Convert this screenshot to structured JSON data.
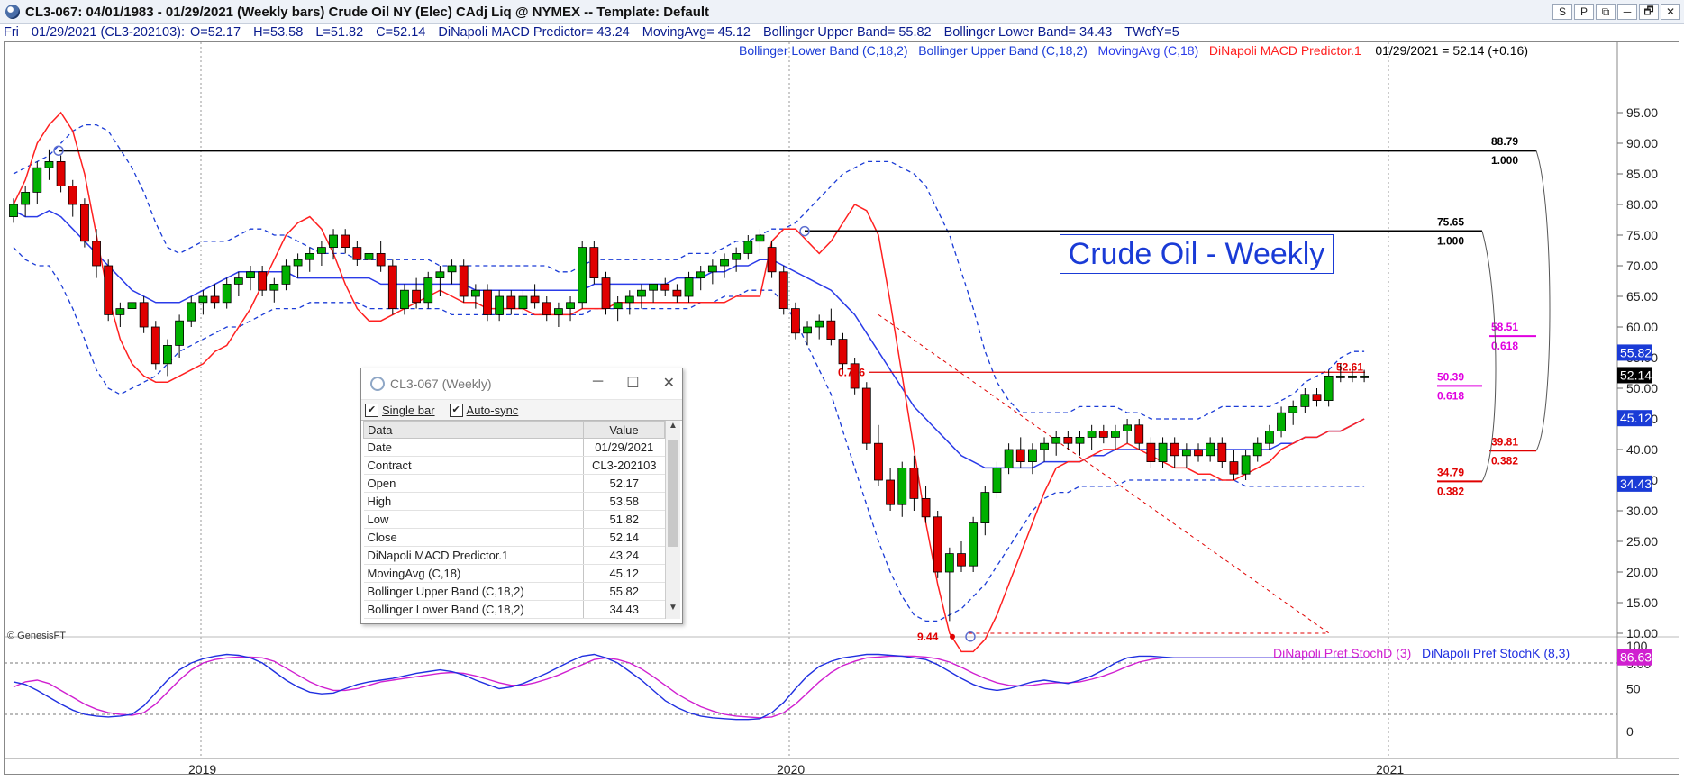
{
  "window": {
    "title": "CL3-067:  04/01/1983 - 01/29/2021  (Weekly bars)   Crude Oil NY (Elec) CAdj Liq @ NYMEX  --  Template: Default",
    "buttons": [
      "S",
      "P",
      "⧉",
      "─",
      "🗗",
      "✕"
    ]
  },
  "infobar": {
    "day": "Fri",
    "bar": "01/29/2021 (CL3-202103):",
    "open": "O=52.17",
    "high": "H=53.58",
    "low": "L=51.82",
    "close": "C=52.14",
    "dinapoli": "DiNapoli MACD Predictor= 43.24",
    "ma": "MovingAvg= 45.12",
    "bbu": "Bollinger Upper Band= 55.82",
    "bbl": "Bollinger Lower Band= 34.43",
    "twofy": "TWofY=5"
  },
  "legend": {
    "bbl": "Bollinger Lower Band (C,18,2)",
    "bbu": "Bollinger Upper Band (C,18,2)",
    "ma": "MovingAvg (C,18)",
    "dinapoli": "DiNapoli MACD Predictor.1",
    "last": "01/29/2021 = 52.14 (+0.16)"
  },
  "watermark": "Crude Oil - Weekly",
  "copyright": "© GenesisFT",
  "stoch_legend": {
    "d": "DiNapoli Pref StochD (3)",
    "k": "DiNapoli Pref StochK (8,3)"
  },
  "price_axis": [
    "95.00",
    "90.00",
    "85.00",
    "80.00",
    "75.00",
    "70.00",
    "65.00",
    "60.00",
    "55.00",
    "50.00",
    "45.00",
    "40.00",
    "35.00",
    "30.00",
    "25.00",
    "20.00",
    "15.00",
    "10.00",
    "5.00"
  ],
  "stoch_axis": [
    "100",
    "50",
    "0"
  ],
  "time_axis": [
    "2019",
    "2020",
    "2021"
  ],
  "tags": {
    "bbu": "55.82",
    "close": "52.14",
    "ma": "45.12",
    "bbl": "34.43",
    "stoch": "86.63"
  },
  "levels": {
    "l1_price": "88.79",
    "l1_ratio": "1.000",
    "l2_price": "75.65",
    "l2_ratio": "1.000",
    "l3_price": "58.51",
    "l3_ratio": "0.618",
    "l4_price": "50.39",
    "l4_ratio": "0.618",
    "l5_price": "39.81",
    "l5_ratio": "0.382",
    "l6_price": "34.79",
    "l6_ratio": "0.382",
    "fib_ratio": "0.786",
    "fib_price": "52.61",
    "low_mark": "9.44"
  },
  "colors": {
    "up": "#00b000",
    "down": "#e00000",
    "bb": "#1a3bd6",
    "ma": "#2a3be8",
    "macd": "#ff2020",
    "stochd": "#d020d0",
    "stochk": "#2030e0",
    "magenta": "#e000e0"
  },
  "data_window": {
    "title": "CL3-067 (Weekly)",
    "single_bar": "Single bar",
    "auto_sync": "Auto-sync",
    "headers": [
      "Data",
      "Value"
    ],
    "rows": [
      [
        "Date",
        "01/29/2021"
      ],
      [
        "Contract",
        "CL3-202103"
      ],
      [
        "Open",
        "52.17"
      ],
      [
        "High",
        "53.58"
      ],
      [
        "Low",
        "51.82"
      ],
      [
        "Close",
        "52.14"
      ],
      [
        "DiNapoli MACD Predictor.1",
        "43.24"
      ],
      [
        "MovingAvg (C,18)",
        "45.12"
      ],
      [
        "Bollinger Upper Band (C,18,2)",
        "55.82"
      ],
      [
        "Bollinger Lower Band (C,18,2)",
        "34.43"
      ]
    ]
  },
  "chart_data": {
    "type": "candlestick",
    "title": "Crude Oil - Weekly",
    "ylim": [
      5,
      97
    ],
    "ohlc": [
      [
        78,
        81,
        77,
        80
      ],
      [
        80,
        83,
        78,
        82
      ],
      [
        82,
        87,
        80,
        86
      ],
      [
        86,
        89,
        84,
        87
      ],
      [
        87,
        88,
        82,
        83
      ],
      [
        83,
        84,
        78,
        80
      ],
      [
        80,
        81,
        73,
        74
      ],
      [
        74,
        76,
        68,
        70
      ],
      [
        70,
        71,
        61,
        62
      ],
      [
        62,
        64,
        60,
        63
      ],
      [
        63,
        65,
        60,
        64
      ],
      [
        64,
        65,
        59,
        60
      ],
      [
        60,
        61,
        53,
        54
      ],
      [
        54,
        58,
        52,
        57
      ],
      [
        57,
        62,
        55,
        61
      ],
      [
        61,
        65,
        60,
        64
      ],
      [
        64,
        66,
        62,
        65
      ],
      [
        65,
        67,
        63,
        64
      ],
      [
        64,
        68,
        63,
        67
      ],
      [
        67,
        69,
        65,
        68
      ],
      [
        68,
        70,
        66,
        69
      ],
      [
        69,
        70,
        65,
        66
      ],
      [
        66,
        68,
        64,
        67
      ],
      [
        67,
        71,
        66,
        70
      ],
      [
        70,
        72,
        68,
        71
      ],
      [
        71,
        73,
        69,
        72
      ],
      [
        72,
        74,
        70,
        73
      ],
      [
        73,
        76,
        71,
        75
      ],
      [
        75,
        76,
        72,
        73
      ],
      [
        73,
        74,
        70,
        71
      ],
      [
        71,
        73,
        68,
        72
      ],
      [
        72,
        74,
        69,
        70
      ],
      [
        70,
        71,
        62,
        63
      ],
      [
        63,
        67,
        62,
        66
      ],
      [
        66,
        68,
        63,
        64
      ],
      [
        64,
        69,
        63,
        68
      ],
      [
        68,
        70,
        65,
        69
      ],
      [
        69,
        71,
        67,
        70
      ],
      [
        70,
        71,
        64,
        65
      ],
      [
        65,
        67,
        63,
        66
      ],
      [
        66,
        67,
        61,
        62
      ],
      [
        62,
        66,
        61,
        65
      ],
      [
        65,
        66,
        62,
        63
      ],
      [
        63,
        66,
        62,
        65
      ],
      [
        65,
        67,
        63,
        64
      ],
      [
        64,
        65,
        61,
        62
      ],
      [
        62,
        64,
        60,
        63
      ],
      [
        63,
        65,
        61,
        64
      ],
      [
        64,
        74,
        63,
        73
      ],
      [
        73,
        74,
        67,
        68
      ],
      [
        68,
        69,
        62,
        63
      ],
      [
        63,
        65,
        61,
        64
      ],
      [
        64,
        66,
        62,
        65
      ],
      [
        65,
        67,
        63,
        66
      ],
      [
        66,
        67,
        64,
        67
      ],
      [
        67,
        68,
        65,
        66
      ],
      [
        66,
        67,
        64,
        65
      ],
      [
        65,
        69,
        64,
        68
      ],
      [
        68,
        70,
        66,
        69
      ],
      [
        69,
        71,
        67,
        70
      ],
      [
        70,
        72,
        68,
        71
      ],
      [
        71,
        73,
        69,
        72
      ],
      [
        72,
        75,
        71,
        74
      ],
      [
        74,
        76,
        72,
        75
      ],
      [
        73,
        74,
        68,
        69
      ],
      [
        69,
        70,
        62,
        63
      ],
      [
        63,
        64,
        58,
        59
      ],
      [
        59,
        61,
        57,
        60
      ],
      [
        60,
        62,
        58,
        61
      ],
      [
        61,
        63,
        57,
        58
      ],
      [
        58,
        59,
        53,
        54
      ],
      [
        54,
        55,
        49,
        50
      ],
      [
        50,
        51,
        40,
        41
      ],
      [
        41,
        44,
        34,
        35
      ],
      [
        35,
        37,
        30,
        31
      ],
      [
        31,
        38,
        29,
        37
      ],
      [
        37,
        39,
        30,
        32
      ],
      [
        32,
        34,
        28,
        29
      ],
      [
        29,
        30,
        19,
        20
      ],
      [
        20,
        24,
        12,
        23
      ],
      [
        23,
        25,
        20,
        21
      ],
      [
        21,
        29,
        20,
        28
      ],
      [
        28,
        34,
        26,
        33
      ],
      [
        33,
        38,
        32,
        37
      ],
      [
        37,
        41,
        36,
        40
      ],
      [
        40,
        42,
        37,
        38
      ],
      [
        38,
        41,
        36,
        40
      ],
      [
        40,
        42,
        38,
        41
      ],
      [
        41,
        43,
        39,
        42
      ],
      [
        42,
        43,
        40,
        41
      ],
      [
        41,
        43,
        39,
        42
      ],
      [
        42,
        44,
        40,
        43
      ],
      [
        43,
        44,
        41,
        42
      ],
      [
        42,
        44,
        40,
        43
      ],
      [
        43,
        45,
        41,
        44
      ],
      [
        44,
        45,
        40,
        41
      ],
      [
        41,
        42,
        37,
        38
      ],
      [
        38,
        42,
        37,
        41
      ],
      [
        41,
        42,
        37,
        39
      ],
      [
        39,
        41,
        37,
        40
      ],
      [
        40,
        41,
        38,
        39
      ],
      [
        39,
        42,
        38,
        41
      ],
      [
        41,
        42,
        37,
        38
      ],
      [
        38,
        40,
        35,
        36
      ],
      [
        36,
        40,
        35,
        39
      ],
      [
        39,
        42,
        38,
        41
      ],
      [
        41,
        44,
        40,
        43
      ],
      [
        43,
        47,
        42,
        46
      ],
      [
        46,
        48,
        44,
        47
      ],
      [
        47,
        50,
        46,
        49
      ],
      [
        49,
        50,
        47,
        48
      ],
      [
        48,
        53,
        47,
        52
      ],
      [
        52,
        54,
        51,
        52
      ],
      [
        52,
        53,
        51,
        52
      ],
      [
        52,
        53,
        51,
        52
      ]
    ],
    "ma": [
      79,
      78,
      78,
      79,
      78,
      76,
      74,
      72,
      70,
      68,
      66,
      65,
      64,
      64,
      64,
      65,
      66,
      67,
      68,
      69,
      69,
      69,
      69,
      69,
      68,
      68,
      68,
      68,
      68,
      68,
      68,
      67,
      67,
      67,
      67,
      67,
      67,
      67,
      67,
      66,
      66,
      66,
      66,
      66,
      66,
      66,
      66,
      66,
      66,
      67,
      67,
      67,
      67,
      67,
      67,
      67,
      68,
      68,
      68,
      69,
      69,
      70,
      70,
      71,
      71,
      70,
      69,
      68,
      67,
      66,
      64,
      62,
      59,
      56,
      53,
      50,
      47,
      45,
      43,
      41,
      39,
      38,
      37,
      37,
      37,
      37,
      37,
      38,
      38,
      38,
      38,
      39,
      39,
      40,
      40,
      40,
      40,
      40,
      40,
      40,
      40,
      40,
      40,
      40,
      40,
      40,
      40,
      41,
      41,
      42,
      42,
      43,
      43,
      44,
      45
    ],
    "bbu": [
      85,
      86,
      87,
      88,
      90,
      92,
      93,
      93,
      92,
      89,
      86,
      82,
      77,
      73,
      72,
      73,
      74,
      74,
      74,
      75,
      76,
      76,
      75,
      75,
      74,
      73,
      72,
      72,
      72,
      71,
      71,
      71,
      71,
      71,
      71,
      71,
      70,
      70,
      70,
      70,
      70,
      70,
      70,
      70,
      70,
      70,
      69,
      69,
      70,
      71,
      71,
      71,
      71,
      71,
      71,
      71,
      71,
      72,
      72,
      72,
      73,
      74,
      74,
      75,
      76,
      76,
      77,
      79,
      81,
      83,
      85,
      86,
      87,
      87,
      87,
      86,
      85,
      83,
      79,
      75,
      69,
      63,
      56,
      51,
      48,
      46,
      46,
      46,
      46,
      46,
      47,
      47,
      47,
      47,
      46,
      46,
      45,
      45,
      45,
      45,
      45,
      46,
      47,
      47,
      47,
      47,
      47,
      48,
      49,
      51,
      52,
      53,
      55,
      56,
      56
    ],
    "bbl": [
      73,
      71,
      70,
      70,
      67,
      63,
      58,
      53,
      50,
      49,
      50,
      51,
      52,
      54,
      56,
      57,
      58,
      59,
      60,
      60,
      61,
      62,
      63,
      63,
      63,
      64,
      64,
      64,
      64,
      64,
      63,
      63,
      63,
      63,
      63,
      63,
      63,
      62,
      62,
      62,
      62,
      62,
      62,
      62,
      62,
      62,
      62,
      62,
      62,
      63,
      63,
      63,
      63,
      63,
      63,
      63,
      63,
      63,
      64,
      64,
      65,
      65,
      66,
      66,
      66,
      64,
      61,
      57,
      53,
      49,
      43,
      37,
      31,
      25,
      20,
      16,
      13,
      12,
      12,
      13,
      14,
      16,
      18,
      21,
      24,
      27,
      30,
      32,
      33,
      33,
      34,
      34,
      34,
      34,
      35,
      35,
      35,
      35,
      35,
      35,
      35,
      35,
      35,
      35,
      34,
      34,
      34,
      34,
      34,
      34,
      34,
      34,
      34,
      34,
      34
    ],
    "macd": [
      80,
      84,
      90,
      93,
      95,
      92,
      85,
      75,
      65,
      58,
      54,
      52,
      51,
      51,
      52,
      53,
      54,
      56,
      57,
      60,
      63,
      67,
      71,
      75,
      77,
      78,
      76,
      72,
      67,
      63,
      61,
      61,
      62,
      63,
      64,
      65,
      66,
      65,
      64,
      64,
      63,
      63,
      63,
      63,
      62,
      62,
      62,
      62,
      63,
      63,
      63,
      64,
      64,
      64,
      64,
      64,
      64,
      64,
      64,
      64,
      64,
      65,
      65,
      65,
      74,
      76,
      76,
      74,
      72,
      74,
      77,
      80,
      79,
      75,
      64,
      52,
      40,
      28,
      18,
      10,
      7,
      7,
      9,
      13,
      18,
      23,
      28,
      33,
      37,
      38,
      38,
      39,
      40,
      40,
      41,
      40,
      39,
      38,
      37,
      37,
      36,
      36,
      35,
      35,
      36,
      37,
      38,
      40,
      41,
      42,
      42,
      43,
      43,
      44,
      45
    ],
    "stoch_k": [
      58,
      55,
      48,
      40,
      32,
      25,
      20,
      18,
      17,
      18,
      20,
      30,
      45,
      60,
      72,
      80,
      85,
      88,
      90,
      89,
      86,
      80,
      70,
      60,
      52,
      46,
      44,
      45,
      50,
      55,
      58,
      60,
      62,
      65,
      68,
      70,
      72,
      70,
      66,
      60,
      55,
      50,
      52,
      56,
      62,
      68,
      75,
      82,
      88,
      90,
      86,
      80,
      70,
      60,
      48,
      36,
      28,
      22,
      18,
      16,
      15,
      14,
      14,
      15,
      22,
      34,
      50,
      65,
      76,
      82,
      86,
      88,
      90,
      90,
      89,
      88,
      86,
      84,
      78,
      70,
      62,
      55,
      50,
      48,
      50,
      54,
      58,
      60,
      58,
      56,
      60,
      65,
      72,
      80,
      86,
      88,
      88,
      87,
      86,
      86,
      86,
      86,
      86,
      86,
      86,
      86,
      86,
      86,
      86,
      86,
      86,
      86,
      86,
      86,
      86
    ],
    "stoch_d": [
      52,
      58,
      60,
      56,
      48,
      40,
      32,
      26,
      22,
      20,
      19,
      22,
      32,
      46,
      60,
      72,
      80,
      84,
      86,
      87,
      87,
      86,
      82,
      74,
      66,
      58,
      52,
      48,
      48,
      50,
      54,
      58,
      60,
      62,
      64,
      66,
      68,
      69,
      68,
      65,
      61,
      57,
      54,
      54,
      57,
      61,
      66,
      72,
      78,
      84,
      86,
      84,
      80,
      73,
      64,
      54,
      44,
      36,
      29,
      24,
      20,
      18,
      17,
      16,
      17,
      22,
      32,
      45,
      58,
      69,
      77,
      82,
      86,
      87,
      88,
      88,
      88,
      87,
      85,
      81,
      75,
      68,
      62,
      57,
      54,
      53,
      54,
      56,
      57,
      57,
      58,
      61,
      65,
      70,
      76,
      81,
      84,
      86,
      86,
      86,
      86,
      86,
      86,
      86,
      86,
      86,
      86,
      86,
      86,
      86,
      86,
      86,
      86,
      86,
      86
    ]
  }
}
